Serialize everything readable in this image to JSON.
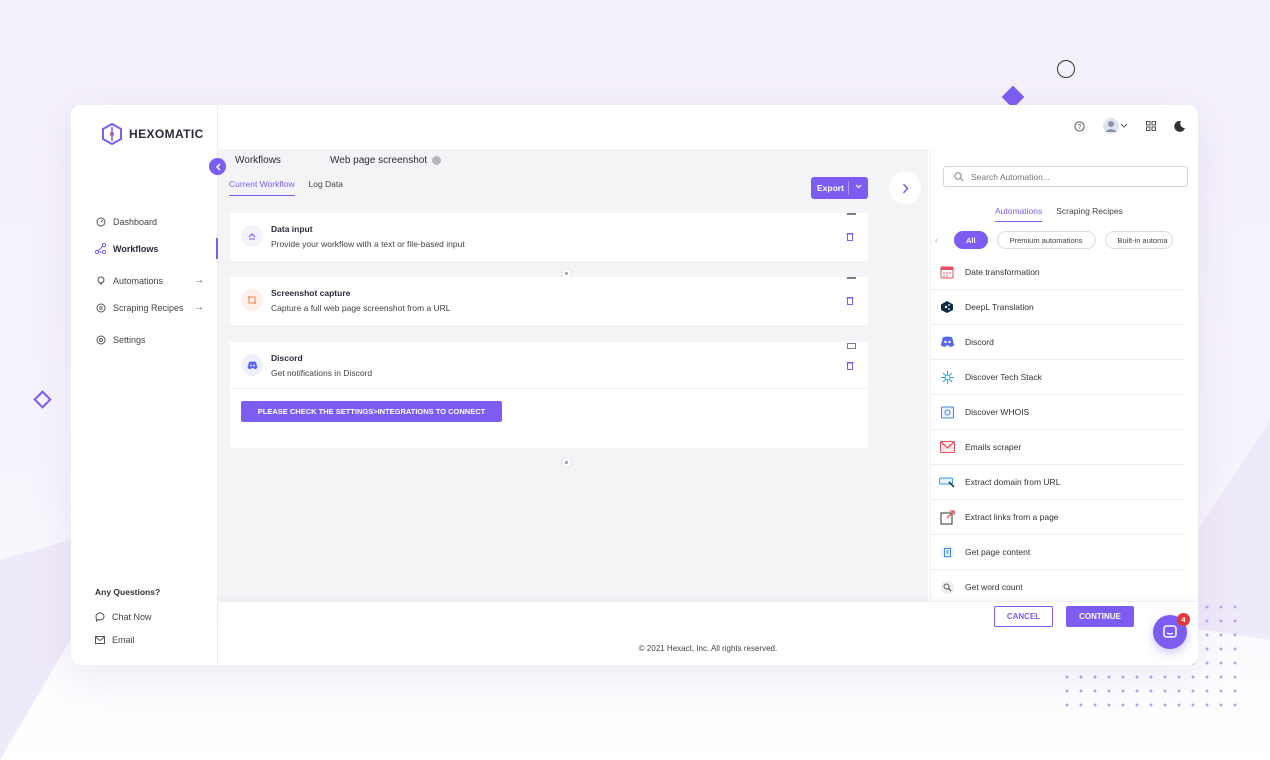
{
  "brand": {
    "name": "HEXOMATIC",
    "color": "#7d5cf2"
  },
  "sidebar": {
    "items": [
      {
        "label": "Dashboard",
        "icon": "dashboard-icon"
      },
      {
        "label": "Workflows",
        "icon": "workflow-icon",
        "active": true
      },
      {
        "label": "Automations",
        "icon": "automation-icon",
        "arrow": "→"
      },
      {
        "label": "Scraping Recipes",
        "icon": "recipe-icon",
        "arrow": "→"
      },
      {
        "label": "Settings",
        "icon": "settings-icon"
      }
    ],
    "questions_label": "Any Questions?",
    "chat_label": "Chat Now",
    "email_label": "Email"
  },
  "header": {
    "breadcrumb": "Workflows",
    "workflow_name": "Web page screenshot",
    "tabs": [
      "Current Workflow",
      "Log Data"
    ],
    "export_label": "Export"
  },
  "workflow": {
    "nodes": [
      {
        "title": "Data input",
        "description": "Provide your workflow with a text or file-based input",
        "icon": "data-input-icon"
      },
      {
        "title": "Screenshot capture",
        "description": "Capture a full web page screenshot from a URL",
        "icon": "screenshot-icon"
      },
      {
        "title": "Discord",
        "description": "Get notifications in Discord",
        "icon": "discord-icon"
      }
    ],
    "warning_button": "PLEASE CHECK THE SETTINGS>INTEGRATIONS TO CONNECT"
  },
  "panel": {
    "search_placeholder": "Search Automation...",
    "tabs": [
      "Automations",
      "Scraping Recipes"
    ],
    "chips": [
      "All",
      "Premium automations",
      "Built-in automa"
    ],
    "automations": [
      {
        "label": "Date transformation",
        "icon": "calendar-icon",
        "color": "#e84c5a"
      },
      {
        "label": "DeepL Translation",
        "icon": "deepl-icon",
        "color": "#0f2b46"
      },
      {
        "label": "Discord",
        "icon": "discord-icon",
        "color": "#5865f2"
      },
      {
        "label": "Discover Tech Stack",
        "icon": "tech-stack-icon",
        "color": "#2fa3e3"
      },
      {
        "label": "Discover WHOIS",
        "icon": "whois-icon",
        "color": "#3d8be0"
      },
      {
        "label": "Emails scraper",
        "icon": "email-icon",
        "color": "#e84c5a"
      },
      {
        "label": "Extract domain from URL",
        "icon": "domain-icon",
        "color": "#2fa3e3"
      },
      {
        "label": "Extract links from a page",
        "icon": "link-icon",
        "color": "#e84c5a"
      },
      {
        "label": "Get page content",
        "icon": "page-content-icon",
        "color": "#3d8be0"
      },
      {
        "label": "Get word count",
        "icon": "word-count-icon",
        "color": "#7a7a88"
      }
    ]
  },
  "actions": {
    "cancel_label": "CANCEL",
    "continue_label": "CONTINUE"
  },
  "footer": {
    "copyright": "© 2021 Hexact, Inc. All rights reserved."
  },
  "chat_widget": {
    "badge_count": "4"
  }
}
